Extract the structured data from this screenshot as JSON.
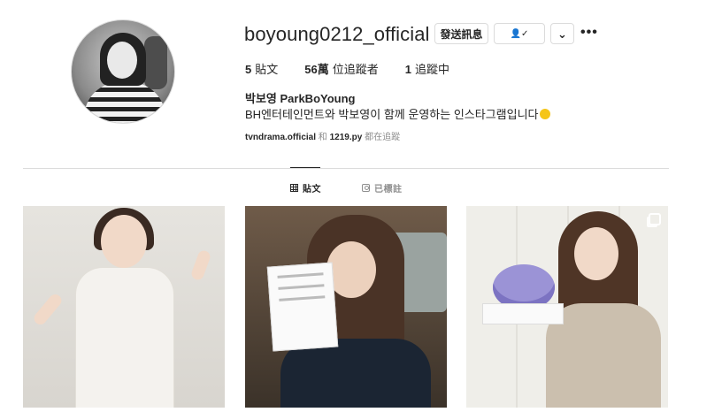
{
  "profile": {
    "username": "boyoung0212_official",
    "message_label": "發送訊息",
    "follow_glyph": "👤✓",
    "more_glyph": "⌄",
    "options_glyph": "•••"
  },
  "stats": [
    {
      "value": "5",
      "label": "貼文"
    },
    {
      "value": "56萬",
      "label": "位追蹤者"
    },
    {
      "value": "1",
      "label": "追蹤中"
    }
  ],
  "bio": {
    "name": "박보영 ParkBoYoung",
    "text": "BH엔터테인먼트와 박보영이 함께 운영하는 인스타그램입니다",
    "emoji": "smiling-face-emoji",
    "followed_by": {
      "first": "tvndrama.official",
      "join": " 和 ",
      "second": "1219.py",
      "suffix": " 都在追蹤"
    }
  },
  "tabs": [
    {
      "label": "貼文",
      "icon": "grid-icon",
      "active": true
    },
    {
      "label": "已標註",
      "icon": "tagged-icon",
      "active": false
    }
  ],
  "posts": [
    {
      "icon": null
    },
    {
      "icon": null
    },
    {
      "icon": "multiple-photos-icon"
    }
  ],
  "colors": {
    "text": "#262626",
    "muted": "#8e8e8e",
    "border": "#dbdbdb"
  }
}
